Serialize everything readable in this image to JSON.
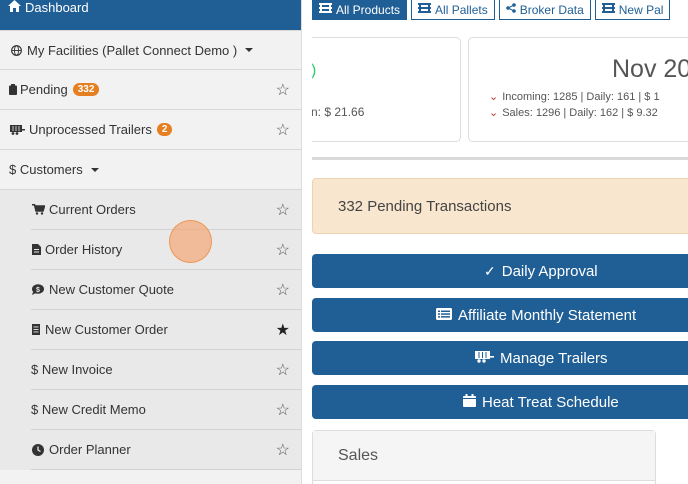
{
  "sidebar": {
    "dashboard": "Dashboard",
    "facilities": "My Facilities (Pallet Connect Demo )",
    "pending": {
      "label": "Pending",
      "badge": "332"
    },
    "unprocessed": {
      "label": "Unprocessed Trailers",
      "badge": "2"
    },
    "customers": "$ Customers",
    "sub_items": [
      {
        "label": "Current Orders",
        "icon": "cart-icon",
        "starred": false
      },
      {
        "label": "Order History",
        "icon": "file-icon",
        "starred": false
      },
      {
        "label": "New Customer Quote",
        "icon": "comment-dollar-icon",
        "starred": false
      },
      {
        "label": "New Customer Order",
        "icon": "document-icon",
        "starred": true
      },
      {
        "label": "$ New Invoice",
        "icon": "",
        "starred": false
      },
      {
        "label": "$ New Credit Memo",
        "icon": "",
        "starred": false
      },
      {
        "label": "Order Planner",
        "icon": "clock-icon",
        "starred": false
      }
    ]
  },
  "tabs": [
    {
      "label": "All Products",
      "active": true
    },
    {
      "label": "All Pallets",
      "active": false
    },
    {
      "label": "Broker Data",
      "active": false
    },
    {
      "label": "New Pal",
      "active": false
    }
  ],
  "card1": {
    "text": "n: $ 21.66"
  },
  "card2": {
    "date": "Nov 20",
    "incoming": "Incoming: 1285 | Daily: 161 | $ 1",
    "sales": "Sales: 1296 | Daily: 162 | $ 9.32"
  },
  "pending_banner": "332 Pending Transactions",
  "buttons": {
    "daily_approval": "Daily Approval",
    "affiliate": "Affiliate Monthly Statement",
    "trailers": "Manage Trailers",
    "heat_treat": "Heat Treat Schedule"
  },
  "sales_panel": {
    "title": "Sales"
  },
  "colors": {
    "primary": "#1f5f96",
    "badge": "#e67e22",
    "pending_bg": "#f8e6cf"
  }
}
